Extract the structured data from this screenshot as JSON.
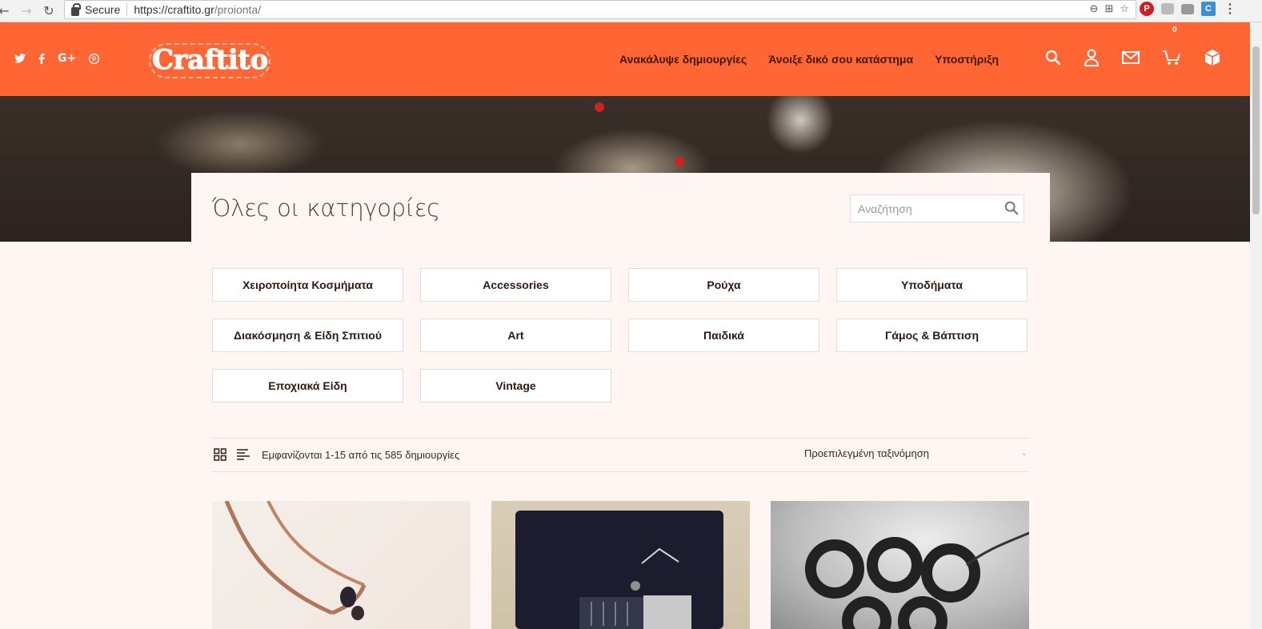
{
  "browser": {
    "secure_label": "Secure",
    "url_host": "https://craftito.gr",
    "url_path": "/proionta/"
  },
  "header": {
    "logo_text": "Craftito",
    "nav": [
      {
        "label": "Ανακάλυψε δημιουργίες"
      },
      {
        "label": "Άνοιξε δικό σου κατάστημα"
      },
      {
        "label": "Υποστήριξη"
      }
    ],
    "cart_count": "0",
    "brand_color": "#ff6633"
  },
  "page": {
    "title": "Όλες οι κατηγορίες",
    "search_placeholder": "Αναζήτηση"
  },
  "categories": [
    {
      "label": "Χειροποίητα Κοσμήματα"
    },
    {
      "label": "Accessories"
    },
    {
      "label": "Ρούχα"
    },
    {
      "label": "Υποδήματα"
    },
    {
      "label": "Διακόσμηση & Είδη Σπιτιού"
    },
    {
      "label": "Art"
    },
    {
      "label": "Παιδικά"
    },
    {
      "label": "Γάμος & Βάπτιση"
    },
    {
      "label": "Εποχιακά Είδη"
    },
    {
      "label": "Vintage"
    }
  ],
  "toolbar": {
    "result_count": "Εμφανίζονται 1-15 από τις 585 δημιουργίες",
    "sort_selected": "Προεπιλεγμένη ταξινόμηση"
  },
  "icons": {
    "social": [
      "twitter-icon",
      "facebook-icon",
      "google-plus-icon",
      "pinterest-icon"
    ],
    "header": [
      "search-icon",
      "user-icon",
      "mail-icon",
      "cart-icon",
      "box-icon"
    ]
  }
}
